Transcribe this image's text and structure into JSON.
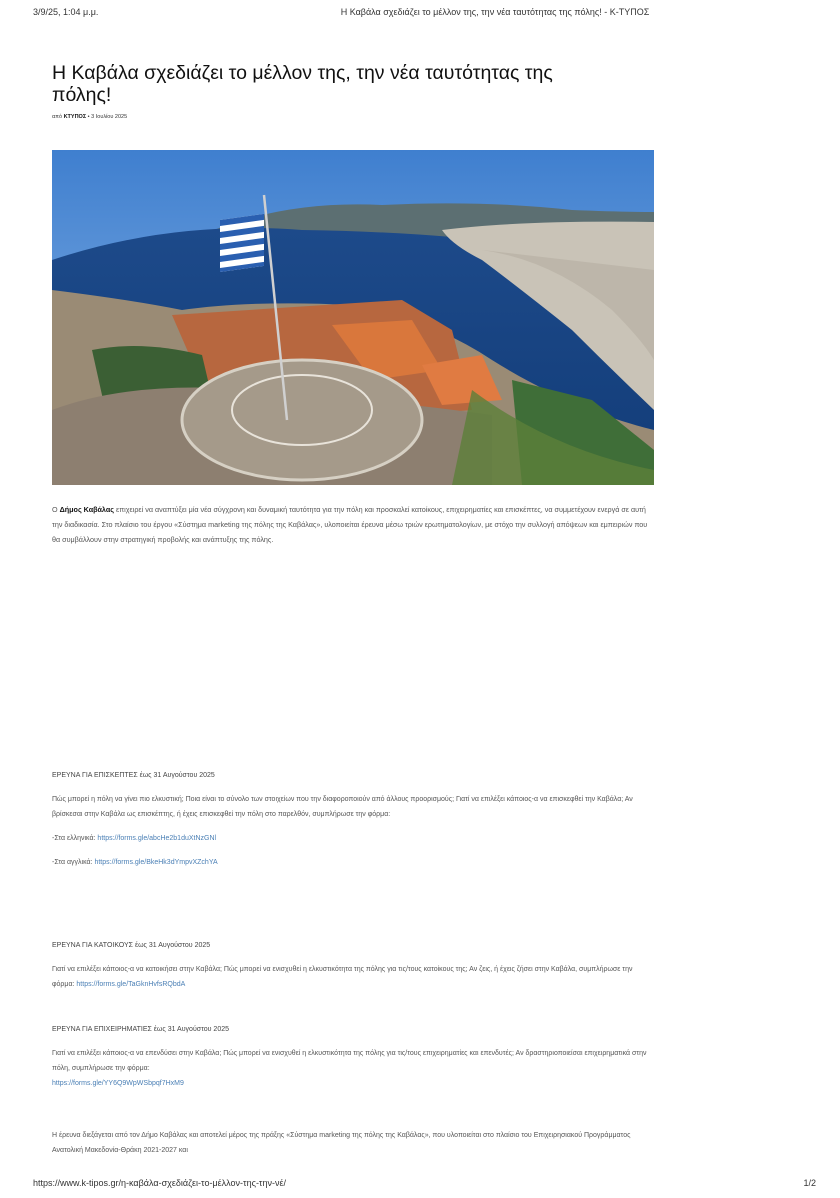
{
  "print_header": {
    "date": "3/9/25, 1:04 μ.μ.",
    "title": "Η Καβάλα σχεδιάζει το μέλλον της, την νέα ταυτότητας της πόλης! - K-ΤΥΠΟΣ"
  },
  "article": {
    "title": "Η Καβάλα σχεδιάζει το μέλλον της, την νέα ταυτότητας της πόλης!",
    "byline_prefix": "από",
    "author": "ΚΤΥΠΟΣ",
    "date": "3 Ιουλίου 2025",
    "lead_bold": "Δήμος Καβάλας",
    "lead_prefix": "Ο",
    "lead_text": "επιχειρεί να αναπτύξει μία νέα σύγχρονη και δυναμική ταυτότητα για την πόλη και προσκαλεί κατοίκους, επιχειρηματίες και επισκέπτες, να συμμετέχουν ενεργά σε αυτή την διαδικασία. Στο πλαίσιο του έργου «Σύστημα marketing της πόλης της Καβάλας», υλοποιείται έρευνα μέσω τριών ερωτηματολογίων, με στόχο την συλλογή απόψεων και εμπειριών που θα συμβάλλουν στην στρατηγική προβολής και ανάπτυξης της πόλης.",
    "visitors": {
      "heading": "ΕΡΕΥΝΑ ΓΙΑ ΕΠΙΣΚΕΠΤΕΣ έως 31 Αυγούστου 2025",
      "text": "Πώς μπορεί η πόλη να γίνει πιο ελκυστική; Ποια είναι το σύνολο των στοιχείων που την διαφοροποιούν από άλλους προορισμούς; Γιατί να επιλέξει κάποιος-α να επισκεφθεί την Καβάλα; Αν βρίσκεσαι στην Καβάλα ως επισκέπτης, ή έχεις επισκεφθεί την πόλη στο παρελθόν, συμπλήρωσε την φόρμα:",
      "greek_label": "-Στα ελληνικά:",
      "greek_link": "https://forms.gle/abcHe2b1duXtNzGNl",
      "english_label": "-Στα αγγλικά:",
      "english_link": "https://forms.gle/BkeHk3dYmpvXZchYA"
    },
    "residents": {
      "heading": "ΕΡΕΥΝΑ ΓΙΑ ΚΑΤΟΙΚΟΥΣ έως 31 Αυγούστου 2025",
      "text": "Γιατί να επιλέξει κάποιος-α να κατοικήσει στην Καβάλα; Πώς μπορεί να ενισχυθεί η ελκυστικότητα της πόλης για τις/τους κατοίκους της; Αν ζεις, ή έχεις ζήσει στην Καβάλα, συμπλήρωσε την φόρμα:",
      "link": "https://forms.gle/TaGknHvfsRQbdA"
    },
    "businesses": {
      "heading": "ΕΡΕΥΝΑ ΓΙΑ ΕΠΙΧΕΙΡΗΜΑΤΙΕΣ έως 31 Αυγούστου 2025",
      "text": "Γιατί να επιλέξει κάποιος-α να επενδύσει στην Καβάλα; Πώς μπορεί να ενισχυθεί η ελκυστικότητα της πόλης για τις/τους επιχειρηματίες και επενδυτές; Αν δραστηριοποιείσαι επιχειρηματικά στην πόλη, συμπλήρωσε την φόρμα:",
      "link": "https://forms.gle/YY6Q9WpWSbpqf7HxM9"
    },
    "closing": "Η έρευνα διεξάγεται από τον Δήμο Καβάλας και αποτελεί μέρος της πράξης «Σύστημα marketing της πόλης της Καβάλας», που υλοποιείται στο πλαίσιο του Επιχειρησιακού Προγράμματος Ανατολική Μακεδονία-Θράκη 2021-2027 και"
  },
  "print_footer": {
    "url": "https://www.k-tipos.gr/η-καβάλα-σχεδιάζει-το-μέλλον-της-την-νέ/",
    "page": "1/2"
  }
}
